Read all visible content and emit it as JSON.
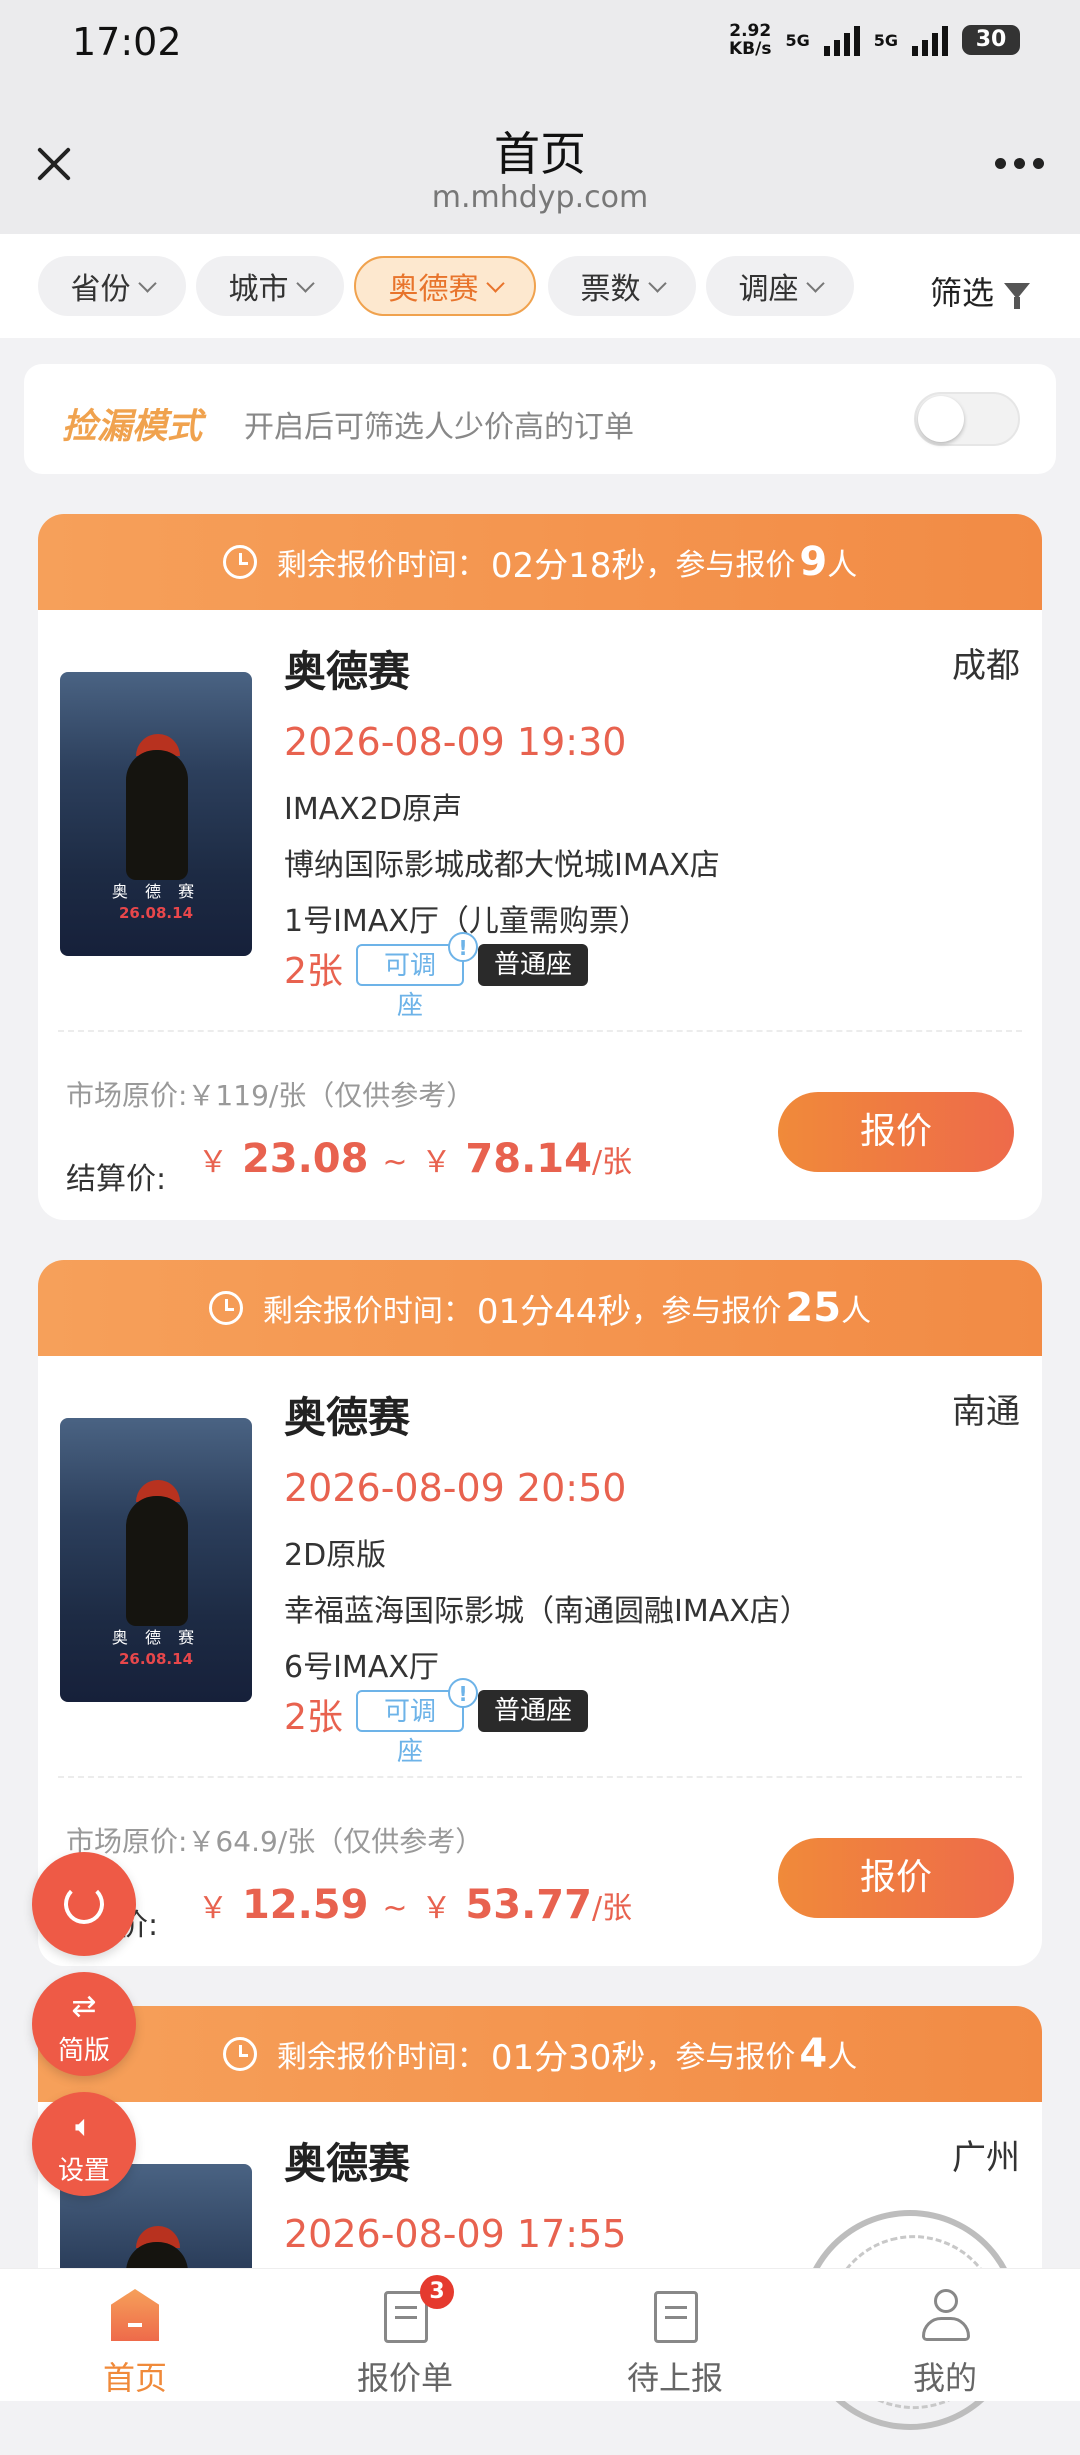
{
  "status": {
    "time": "17:02",
    "speed": "2.92",
    "speed_unit": "KB/s",
    "net1": "5G",
    "net2": "5G",
    "battery": "30"
  },
  "header": {
    "title": "首页",
    "url": "m.mhdyp.com"
  },
  "filters": {
    "chips": [
      {
        "label": "省份"
      },
      {
        "label": "城市"
      },
      {
        "label": "奥德赛"
      },
      {
        "label": "票数"
      },
      {
        "label": "调座"
      }
    ],
    "filter_label": "筛选"
  },
  "bargain": {
    "title": "捡漏模式",
    "desc": "开启后可筛选人少价高的订单",
    "enabled": false
  },
  "cards": [
    {
      "countdown_label": "剩余报价时间：",
      "countdown": "02分18秒",
      "participants_label": "，参与报价",
      "participants": "9",
      "participants_unit": "人",
      "movie": "奥德赛",
      "city": "成都",
      "showtime": "2026-08-09 19:30",
      "format": "IMAX2D原声",
      "cinema": "博纳国际影城成都大悦城IMAX店",
      "hall": "1号IMAX厅（儿童需购票）",
      "qty": "2张",
      "tag_adjust": "可调座",
      "tag_seat": "普通座",
      "market_price": "市场原价:￥119/张（仅供参考）",
      "settle_label": "结算价:",
      "price_low": "23.08",
      "price_high": "78.14",
      "button": "报价"
    },
    {
      "countdown_label": "剩余报价时间：",
      "countdown": "01分44秒",
      "participants_label": "，参与报价",
      "participants": "25",
      "participants_unit": "人",
      "movie": "奥德赛",
      "city": "南通",
      "showtime": "2026-08-09 20:50",
      "format": "2D原版",
      "cinema": "幸福蓝海国际影城（南通圆融IMAX店）",
      "hall": "6号IMAX厅",
      "qty": "2张",
      "tag_adjust": "可调座",
      "tag_seat": "普通座",
      "market_price": "市场原价:￥64.9/张（仅供参考）",
      "settle_label": "价:",
      "price_low": "12.59",
      "price_high": "53.77",
      "button": "报价"
    },
    {
      "countdown_label": "剩余报价时间：",
      "countdown": "01分30秒",
      "participants_label": "，参与报价",
      "participants": "4",
      "participants_unit": "人",
      "movie": "奥德赛",
      "city": "广州",
      "showtime": "2026-08-09 17:55"
    }
  ],
  "poster": {
    "title": "奥 德 赛",
    "date": "26.08.14"
  },
  "price_symbol": "￥",
  "price_sep": "~",
  "price_unit": "/张",
  "fabs": {
    "mode": "简版",
    "settings": "设置"
  },
  "nav": [
    {
      "label": "首页"
    },
    {
      "label": "报价单",
      "badge": "3"
    },
    {
      "label": "待上报"
    },
    {
      "label": "我的"
    }
  ],
  "colors": {
    "accent": "#f08a3a",
    "price": "#e8624f",
    "tag_blue": "#6db3e8",
    "bg": "#f2f2f4"
  }
}
